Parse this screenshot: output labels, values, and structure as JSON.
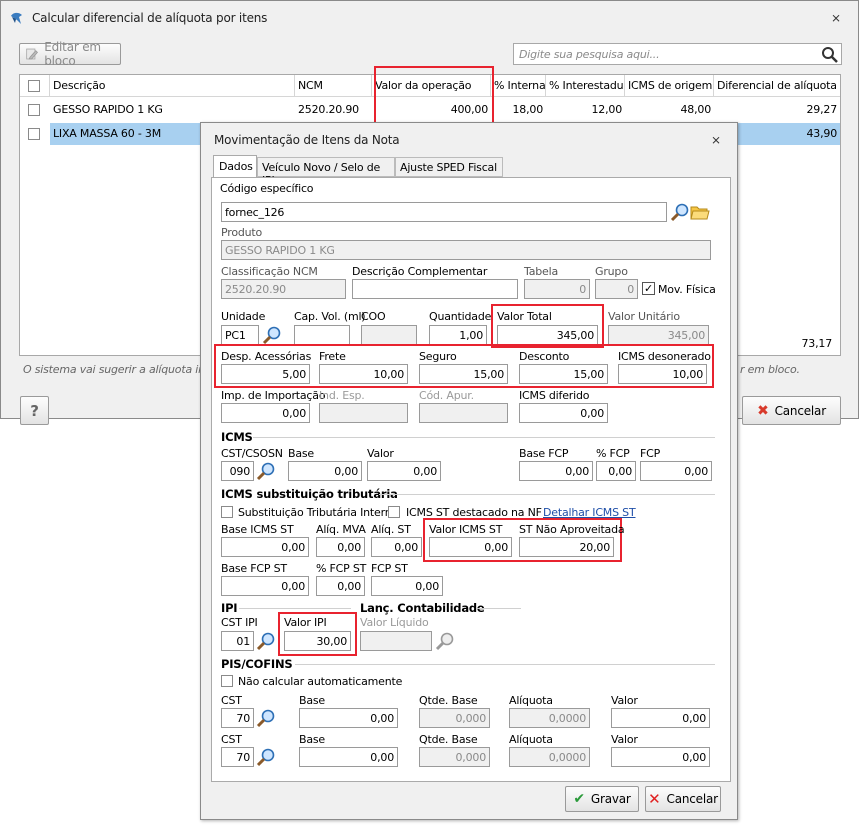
{
  "main": {
    "title": "Calcular diferencial de alíquota por itens",
    "edit_button": "Editar em bloco",
    "search_placeholder": "Digite sua pesquisa aqui...",
    "columns": [
      "Descrição",
      "NCM",
      "Valor da operação",
      "% Interna",
      "% Interestadual",
      "ICMS de origem",
      "Diferencial de alíquota"
    ],
    "rows": [
      {
        "desc": "GESSO RAPIDO 1 KG",
        "ncm": "2520.20.90",
        "valor": "400,00",
        "interna": "18,00",
        "interestadual": "12,00",
        "origem": "48,00",
        "diferencial": "29,27"
      },
      {
        "desc": "LIXA MASSA  60 - 3M",
        "diferencial": "43,90"
      }
    ],
    "total": "73,17",
    "hint_left": "O sistema vai sugerir a alíquota in",
    "hint_right": "r em bloco.",
    "help_button": "?",
    "cancel_button": "Cancelar"
  },
  "dialog": {
    "title": "Movimentação de Itens da Nota",
    "tabs": [
      "Dados",
      "Veículo Novo / Selo de IPI",
      "Ajuste SPED Fiscal"
    ],
    "codigo_label": "Código específico",
    "codigo_value": "fornec_126",
    "produto_label": "Produto",
    "produto_value": "GESSO RAPIDO 1 KG",
    "ncm_label": "Classificação NCM",
    "ncm_value": "2520.20.90",
    "desc_comp_label": "Descrição Complementar",
    "desc_comp_value": "",
    "tabela_label": "Tabela",
    "tabela_value": "0",
    "grupo_label": "Grupo",
    "grupo_value": "0",
    "mov_fisica_label": "Mov. Física",
    "unidade_label": "Unidade",
    "unidade_value": "PC1",
    "capvol_label": "Cap. Vol. (ml)",
    "capvol_value": "",
    "coo_label": "COO",
    "coo_value": "",
    "quantidade_label": "Quantidade",
    "quantidade_value": "1,00",
    "valor_total_label": "Valor Total",
    "valor_total_value": "345,00",
    "valor_unit_label": "Valor Unitário",
    "valor_unit_value": "345,00",
    "desp_label": "Desp. Acessórias",
    "desp_value": "5,00",
    "frete_label": "Frete",
    "frete_value": "10,00",
    "seguro_label": "Seguro",
    "seguro_value": "15,00",
    "desconto_label": "Desconto",
    "desconto_value": "15,00",
    "icms_deson_label": "ICMS desonerado",
    "icms_deson_value": "10,00",
    "imp_label": "Imp. de Importação",
    "imp_value": "0,00",
    "ind_esp_label": "Ind. Esp.",
    "cod_apur_label": "Cód. Apur.",
    "icms_dif_label": "ICMS diferido",
    "icms_dif_value": "0,00",
    "icms_section": "ICMS",
    "cst_label": "CST/CSOSN",
    "cst_value": "090",
    "base_label": "Base",
    "base_value": "0,00",
    "valor_label": "Valor",
    "valor_value": "0,00",
    "base_fcp_label": "Base FCP",
    "base_fcp_value": "0,00",
    "pfcp_label": "% FCP",
    "pfcp_value": "0,00",
    "fcp_label": "FCP",
    "fcp_value": "0,00",
    "st_section": "ICMS substituição tributária",
    "st_interna_label": "Substituição Tributária Interna",
    "st_destacado_label": "ICMS ST destacado na NF",
    "detalhar_link": "Detalhar ICMS ST",
    "base_st_label": "Base ICMS ST",
    "base_st_value": "0,00",
    "aliq_mva_label": "Alíq. MVA",
    "aliq_mva_value": "0,00",
    "aliq_st_label": "Alíq. ST",
    "aliq_st_value": "0,00",
    "valor_st_label": "Valor ICMS ST",
    "valor_st_value": "0,00",
    "st_nao_label": "ST Não Aproveitada",
    "st_nao_value": "20,00",
    "base_fcp_st_label": "Base FCP ST",
    "base_fcp_st_value": "0,00",
    "pfcp_st_label": "% FCP ST",
    "pfcp_st_value": "0,00",
    "fcp_st_label": "FCP ST",
    "fcp_st_value": "0,00",
    "ipi_section": "IPI",
    "contab_section": "Lanç. Contabilidade",
    "cst_ipi_label": "CST IPI",
    "cst_ipi_value": "01",
    "valor_ipi_label": "Valor IPI",
    "valor_ipi_value": "30,00",
    "valor_liq_label": "Valor Líquido",
    "pis_section": "PIS/COFINS",
    "nao_calc_label": "Não calcular automaticamente",
    "pis_rows": [
      {
        "cst_label": "CST",
        "cst": "70",
        "base_label": "Base",
        "base": "0,00",
        "qtde_label": "Qtde. Base",
        "qtde": "0,000",
        "aliq_label": "Alíquota",
        "aliq": "0,0000",
        "valor_label": "Valor",
        "valor": "0,00"
      },
      {
        "cst_label": "CST",
        "cst": "70",
        "base_label": "Base",
        "base": "0,00",
        "qtde_label": "Qtde. Base",
        "qtde": "0,000",
        "aliq_label": "Alíquota",
        "aliq": "0,0000",
        "valor_label": "Valor",
        "valor": "0,00"
      }
    ],
    "gravar_button": "Gravar",
    "cancelar_button": "Cancelar"
  },
  "colors": {
    "highlight": "#e8232f",
    "selection": "#a8d0f0",
    "link": "#1f4fa8"
  }
}
